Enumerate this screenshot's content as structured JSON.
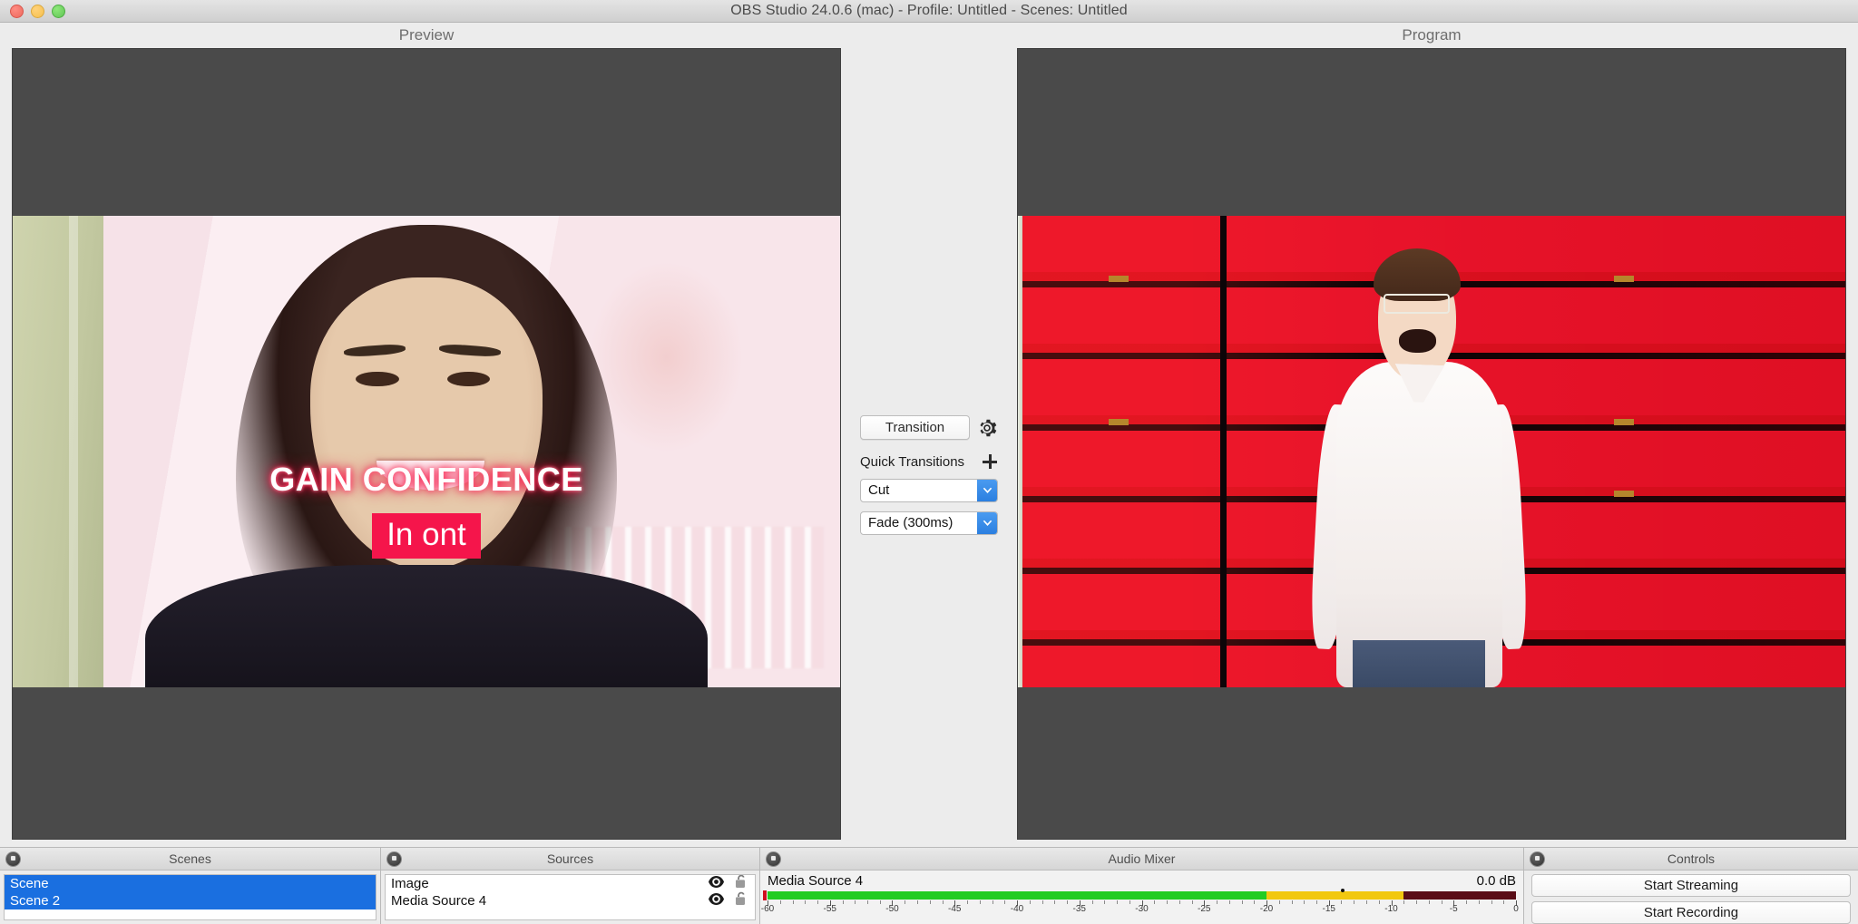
{
  "window": {
    "title": "OBS Studio 24.0.6 (mac) - Profile: Untitled - Scenes: Untitled",
    "traffic_lights": [
      "close",
      "minimize",
      "maximize"
    ]
  },
  "preview": {
    "label": "Preview",
    "overlay_title": "GAIN CONFIDENCE",
    "overlay_badge": "In ont",
    "badge_color": "#f5154b"
  },
  "program": {
    "label": "Program"
  },
  "transitions": {
    "transition_button": "Transition",
    "settings_icon": "gear-icon",
    "quick_transitions_label": "Quick Transitions",
    "add_icon": "plus-icon",
    "quick": [
      {
        "label": "Cut"
      },
      {
        "label": "Fade (300ms)"
      }
    ]
  },
  "scenes": {
    "title": "Scenes",
    "items": [
      {
        "label": "Scene",
        "selected": true
      },
      {
        "label": "Scene 2",
        "selected": true
      }
    ]
  },
  "sources": {
    "title": "Sources",
    "items": [
      {
        "label": "Image",
        "visibility_icon": "eye-icon",
        "lock_icon": "unlock-icon"
      },
      {
        "label": "Media Source 4",
        "visibility_icon": "eye-icon",
        "lock_icon": "unlock-icon"
      }
    ]
  },
  "mixer": {
    "title": "Audio Mixer",
    "channel_name": "Media Source 4",
    "volume_db": "0.0 dB",
    "scale_min": -60,
    "scale_max": 0,
    "scale_labels": [
      -60,
      -55,
      -50,
      -45,
      -40,
      -35,
      -30,
      -25,
      -20,
      -15,
      -10,
      -5,
      0
    ],
    "level_db": -9,
    "peak_db": -14,
    "colors": {
      "green": "#22cc22",
      "yellow": "#f2c80f",
      "red": "#e1344b",
      "inactive": "#5a0d17"
    }
  },
  "controls": {
    "title": "Controls",
    "buttons": [
      {
        "label": "Start Streaming"
      },
      {
        "label": "Start Recording"
      }
    ]
  }
}
